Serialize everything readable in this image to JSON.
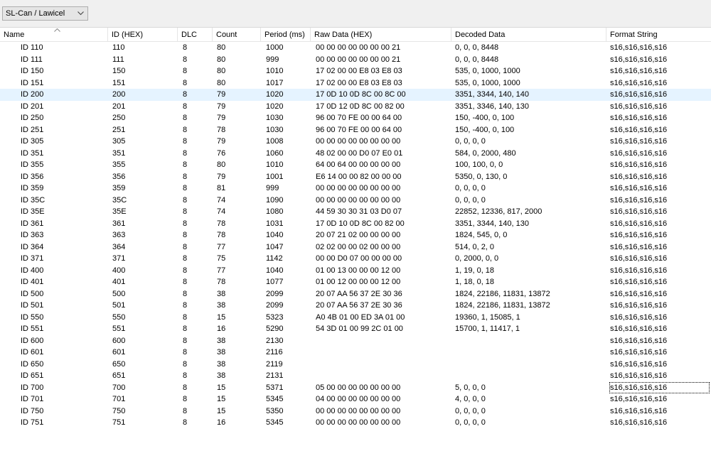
{
  "toolbar": {
    "adapter": "SL-Can / Lawicel"
  },
  "columns": {
    "name": "Name",
    "id": "ID (HEX)",
    "dlc": "DLC",
    "count": "Count",
    "period": "Period (ms)",
    "raw": "Raw Data (HEX)",
    "decoded": "Decoded Data",
    "format": "Format String"
  },
  "rows": [
    {
      "name": "ID 110",
      "id": "110",
      "dlc": "8",
      "count": "80",
      "period": "1000",
      "raw": "00 00 00 00 00 00 00 21",
      "decoded": "0, 0, 0, 8448",
      "format": "s16,s16,s16,s16"
    },
    {
      "name": "ID 111",
      "id": "111",
      "dlc": "8",
      "count": "80",
      "period": "999",
      "raw": "00 00 00 00 00 00 00 21",
      "decoded": "0, 0, 0, 8448",
      "format": "s16,s16,s16,s16"
    },
    {
      "name": "ID 150",
      "id": "150",
      "dlc": "8",
      "count": "80",
      "period": "1010",
      "raw": "17 02 00 00 E8 03 E8 03",
      "decoded": "535, 0, 1000, 1000",
      "format": "s16,s16,s16,s16"
    },
    {
      "name": "ID 151",
      "id": "151",
      "dlc": "8",
      "count": "80",
      "period": "1017",
      "raw": "17 02 00 00 E8 03 E8 03",
      "decoded": "535, 0, 1000, 1000",
      "format": "s16,s16,s16,s16"
    },
    {
      "name": "ID 200",
      "id": "200",
      "dlc": "8",
      "count": "79",
      "period": "1020",
      "raw": "17 0D 10 0D 8C 00 8C 00",
      "decoded": "3351, 3344, 140, 140",
      "format": "s16,s16,s16,s16"
    },
    {
      "name": "ID 201",
      "id": "201",
      "dlc": "8",
      "count": "79",
      "period": "1020",
      "raw": "17 0D 12 0D 8C 00 82 00",
      "decoded": "3351, 3346, 140, 130",
      "format": "s16,s16,s16,s16"
    },
    {
      "name": "ID 250",
      "id": "250",
      "dlc": "8",
      "count": "79",
      "period": "1030",
      "raw": "96 00 70 FE 00 00 64 00",
      "decoded": "150, -400, 0, 100",
      "format": "s16,s16,s16,s16"
    },
    {
      "name": "ID 251",
      "id": "251",
      "dlc": "8",
      "count": "78",
      "period": "1030",
      "raw": "96 00 70 FE 00 00 64 00",
      "decoded": "150, -400, 0, 100",
      "format": "s16,s16,s16,s16"
    },
    {
      "name": "ID 305",
      "id": "305",
      "dlc": "8",
      "count": "79",
      "period": "1008",
      "raw": "00 00 00 00 00 00 00 00",
      "decoded": "0, 0, 0, 0",
      "format": "s16,s16,s16,s16"
    },
    {
      "name": "ID 351",
      "id": "351",
      "dlc": "8",
      "count": "76",
      "period": "1060",
      "raw": "48 02 00 00 D0 07 E0 01",
      "decoded": "584, 0, 2000, 480",
      "format": "s16,s16,s16,s16"
    },
    {
      "name": "ID 355",
      "id": "355",
      "dlc": "8",
      "count": "80",
      "period": "1010",
      "raw": "64 00 64 00 00 00 00 00",
      "decoded": "100, 100, 0, 0",
      "format": "s16,s16,s16,s16"
    },
    {
      "name": "ID 356",
      "id": "356",
      "dlc": "8",
      "count": "79",
      "period": "1001",
      "raw": "E6 14 00 00 82 00 00 00",
      "decoded": "5350, 0, 130, 0",
      "format": "s16,s16,s16,s16"
    },
    {
      "name": "ID 359",
      "id": "359",
      "dlc": "8",
      "count": "81",
      "period": "999",
      "raw": "00 00 00 00 00 00 00 00",
      "decoded": "0, 0, 0, 0",
      "format": "s16,s16,s16,s16"
    },
    {
      "name": "ID 35C",
      "id": "35C",
      "dlc": "8",
      "count": "74",
      "period": "1090",
      "raw": "00 00 00 00 00 00 00 00",
      "decoded": "0, 0, 0, 0",
      "format": "s16,s16,s16,s16"
    },
    {
      "name": "ID 35E",
      "id": "35E",
      "dlc": "8",
      "count": "74",
      "period": "1080",
      "raw": "44 59 30 30 31 03 D0 07",
      "decoded": "22852, 12336, 817, 2000",
      "format": "s16,s16,s16,s16"
    },
    {
      "name": "ID 361",
      "id": "361",
      "dlc": "8",
      "count": "78",
      "period": "1031",
      "raw": "17 0D 10 0D 8C 00 82 00",
      "decoded": "3351, 3344, 140, 130",
      "format": "s16,s16,s16,s16"
    },
    {
      "name": "ID 363",
      "id": "363",
      "dlc": "8",
      "count": "78",
      "period": "1040",
      "raw": "20 07 21 02 00 00 00 00",
      "decoded": "1824, 545, 0, 0",
      "format": "s16,s16,s16,s16"
    },
    {
      "name": "ID 364",
      "id": "364",
      "dlc": "8",
      "count": "77",
      "period": "1047",
      "raw": "02 02 00 00 02 00 00 00",
      "decoded": "514, 0, 2, 0",
      "format": "s16,s16,s16,s16"
    },
    {
      "name": "ID 371",
      "id": "371",
      "dlc": "8",
      "count": "75",
      "period": "1142",
      "raw": "00 00 D0 07 00 00 00 00",
      "decoded": "0, 2000, 0, 0",
      "format": "s16,s16,s16,s16"
    },
    {
      "name": "ID 400",
      "id": "400",
      "dlc": "8",
      "count": "77",
      "period": "1040",
      "raw": "01 00 13 00 00 00 12 00",
      "decoded": "1, 19, 0, 18",
      "format": "s16,s16,s16,s16"
    },
    {
      "name": "ID 401",
      "id": "401",
      "dlc": "8",
      "count": "78",
      "period": "1077",
      "raw": "01 00 12 00 00 00 12 00",
      "decoded": "1, 18, 0, 18",
      "format": "s16,s16,s16,s16"
    },
    {
      "name": "ID 500",
      "id": "500",
      "dlc": "8",
      "count": "38",
      "period": "2099",
      "raw": "20 07 AA 56 37 2E 30 36",
      "decoded": "1824, 22186, 11831, 13872",
      "format": "s16,s16,s16,s16"
    },
    {
      "name": "ID 501",
      "id": "501",
      "dlc": "8",
      "count": "38",
      "period": "2099",
      "raw": "20 07 AA 56 37 2E 30 36",
      "decoded": "1824, 22186, 11831, 13872",
      "format": "s16,s16,s16,s16"
    },
    {
      "name": "ID 550",
      "id": "550",
      "dlc": "8",
      "count": "15",
      "period": "5323",
      "raw": "A0 4B 01 00 ED 3A 01 00",
      "decoded": "19360, 1, 15085, 1",
      "format": "s16,s16,s16,s16"
    },
    {
      "name": "ID 551",
      "id": "551",
      "dlc": "8",
      "count": "16",
      "period": "5290",
      "raw": "54 3D 01 00 99 2C 01 00",
      "decoded": "15700, 1, 11417, 1",
      "format": "s16,s16,s16,s16"
    },
    {
      "name": "ID 600",
      "id": "600",
      "dlc": "8",
      "count": "38",
      "period": "2130",
      "raw": "",
      "decoded": "",
      "format": "s16,s16,s16,s16"
    },
    {
      "name": "ID 601",
      "id": "601",
      "dlc": "8",
      "count": "38",
      "period": "2116",
      "raw": "",
      "decoded": "",
      "format": "s16,s16,s16,s16"
    },
    {
      "name": "ID 650",
      "id": "650",
      "dlc": "8",
      "count": "38",
      "period": "2119",
      "raw": "",
      "decoded": "",
      "format": "s16,s16,s16,s16"
    },
    {
      "name": "ID 651",
      "id": "651",
      "dlc": "8",
      "count": "38",
      "period": "2131",
      "raw": "",
      "decoded": "",
      "format": "s16,s16,s16,s16"
    },
    {
      "name": "ID 700",
      "id": "700",
      "dlc": "8",
      "count": "15",
      "period": "5371",
      "raw": "05 00 00 00 00 00 00 00",
      "decoded": "5, 0, 0, 0",
      "format": "s16,s16,s16,s16"
    },
    {
      "name": "ID 701",
      "id": "701",
      "dlc": "8",
      "count": "15",
      "period": "5345",
      "raw": "04 00 00 00 00 00 00 00",
      "decoded": "4, 0, 0, 0",
      "format": "s16,s16,s16,s16"
    },
    {
      "name": "ID 750",
      "id": "750",
      "dlc": "8",
      "count": "15",
      "period": "5350",
      "raw": "00 00 00 00 00 00 00 00",
      "decoded": "0, 0, 0, 0",
      "format": "s16,s16,s16,s16"
    },
    {
      "name": "ID 751",
      "id": "751",
      "dlc": "8",
      "count": "16",
      "period": "5345",
      "raw": "00 00 00 00 00 00 00 00",
      "decoded": "0, 0, 0, 0",
      "format": "s16,s16,s16,s16"
    }
  ],
  "selected_row_index": 4,
  "focused_row_index": 29,
  "colors": {
    "selected_row": "#e5f3ff",
    "grid_line": "#e5e5e5"
  },
  "icons": {
    "sort": "chevron-up-icon",
    "dropdown": "chevron-down-icon"
  }
}
